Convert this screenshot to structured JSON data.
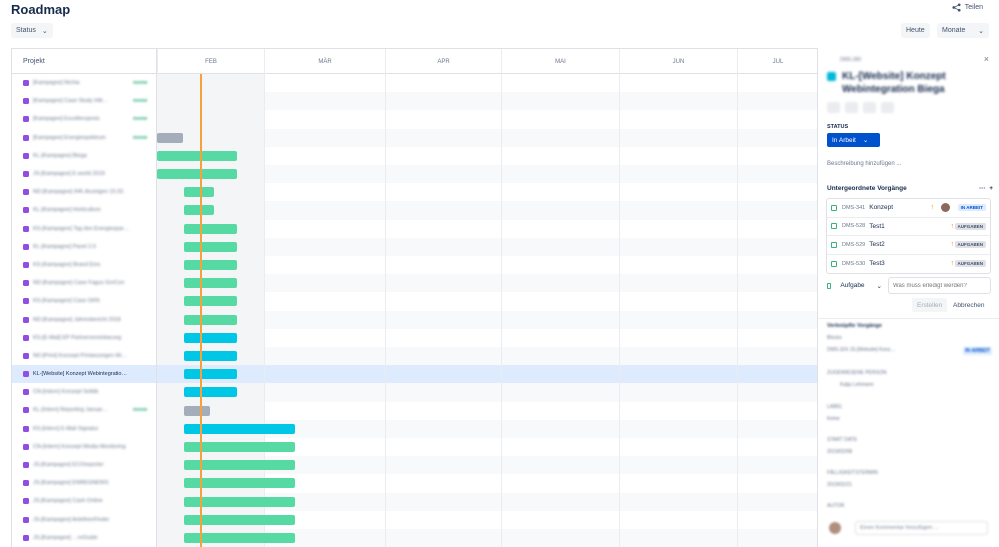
{
  "header": {
    "title": "Roadmap",
    "share_label": "Teilen",
    "status_filter": "Status",
    "today_button": "Heute",
    "zoom_select": "Monate"
  },
  "left_column": {
    "header": "Projekt",
    "rows": [
      {
        "label": "[Kampagne] Nichia",
        "tag": "meme"
      },
      {
        "label": "[Kampagne] Case Study Hitt…",
        "tag": "meme"
      },
      {
        "label": "[Kampagne] Excellenzpreis",
        "tag": "meme"
      },
      {
        "label": "[Kampagne] Energiespektrum",
        "tag": "meme"
      },
      {
        "label": "KL-[Kampagne] Biega",
        "tag": ""
      },
      {
        "label": "JS-[Kampagne] E-world 2019",
        "tag": ""
      },
      {
        "label": "ND-[Kampagne] IHK-Anzeigen 15.02.",
        "tag": ""
      },
      {
        "label": "KL-[Kampagne] Horticulture",
        "tag": ""
      },
      {
        "label": "KS-[Kampagne] Tag des Energiespar…",
        "tag": ""
      },
      {
        "label": "KL-[Kampagne] Panel 2.0",
        "tag": ""
      },
      {
        "label": "KS-[Kampagne] Brand Eins",
        "tag": ""
      },
      {
        "label": "ND-[Kampagne] Case Fagus GreCon",
        "tag": ""
      },
      {
        "label": "KS-[Kampagne] Case GKN",
        "tag": ""
      },
      {
        "label": "ND-[Kampagne] Jahresbericht 2018",
        "tag": ""
      },
      {
        "label": "KS-[E-Mail] EP Partnervereinbarung",
        "tag": ""
      },
      {
        "label": "ND-[Print] Konzept Printanzeigen Mi…",
        "tag": ""
      },
      {
        "label": "KL-[Website] Konzept Webintegratio…",
        "tag": ""
      },
      {
        "label": "CN-[Intern] Konzept Selbtk",
        "tag": ""
      },
      {
        "label": "KL-[Intern] Reporting Januar…",
        "tag": "meme"
      },
      {
        "label": "KS-[Intern] E-Mail Signatur",
        "tag": ""
      },
      {
        "label": "CN-[Intern] Konzept Media-Monitoring",
        "tag": ""
      },
      {
        "label": "JS-[Kampagne] ECOreporter",
        "tag": ""
      },
      {
        "label": "JS-[Kampagne] ENREGNEWS",
        "tag": ""
      },
      {
        "label": "JS-[Kampagne] Cash Online",
        "tag": ""
      },
      {
        "label": "JS-[Kampagne] AnlethenFinder",
        "tag": ""
      },
      {
        "label": "JS-[Kampagne] …reGuide",
        "tag": ""
      }
    ]
  },
  "timeline": {
    "months": [
      "FEB",
      "MÄR",
      "APR",
      "MAI",
      "JUN",
      "JUL"
    ],
    "bars": [
      {
        "row": 3,
        "start": 0,
        "end": 26,
        "color": "grey"
      },
      {
        "row": 4,
        "start": 0,
        "end": 80,
        "color": "green"
      },
      {
        "row": 5,
        "start": 0,
        "end": 80,
        "color": "green"
      },
      {
        "row": 6,
        "start": 27,
        "end": 57,
        "color": "green"
      },
      {
        "row": 7,
        "start": 27,
        "end": 57,
        "color": "green"
      },
      {
        "row": 8,
        "start": 27,
        "end": 80,
        "color": "green"
      },
      {
        "row": 9,
        "start": 27,
        "end": 80,
        "color": "green"
      },
      {
        "row": 10,
        "start": 27,
        "end": 80,
        "color": "green"
      },
      {
        "row": 11,
        "start": 27,
        "end": 80,
        "color": "green"
      },
      {
        "row": 12,
        "start": 27,
        "end": 80,
        "color": "green"
      },
      {
        "row": 13,
        "start": 27,
        "end": 80,
        "color": "green"
      },
      {
        "row": 14,
        "start": 27,
        "end": 80,
        "color": "blue"
      },
      {
        "row": 15,
        "start": 27,
        "end": 80,
        "color": "blue"
      },
      {
        "row": 16,
        "start": 27,
        "end": 80,
        "color": "blue"
      },
      {
        "row": 17,
        "start": 27,
        "end": 80,
        "color": "blue"
      },
      {
        "row": 18,
        "start": 27,
        "end": 53,
        "color": "grey"
      },
      {
        "row": 19,
        "start": 27,
        "end": 138,
        "color": "blue"
      },
      {
        "row": 20,
        "start": 27,
        "end": 138,
        "color": "green"
      },
      {
        "row": 21,
        "start": 27,
        "end": 138,
        "color": "green"
      },
      {
        "row": 22,
        "start": 27,
        "end": 138,
        "color": "green"
      },
      {
        "row": 23,
        "start": 27,
        "end": 138,
        "color": "green"
      },
      {
        "row": 24,
        "start": 27,
        "end": 138,
        "color": "green"
      },
      {
        "row": 25,
        "start": 27,
        "end": 138,
        "color": "green"
      }
    ]
  },
  "panel": {
    "key": "DMS-280",
    "title": "KL-[Website] Konzept Webintegration Biega",
    "status_label": "STATUS",
    "status_value": "In Arbeit",
    "description_placeholder": "Beschreibung hinzufügen ...",
    "subtasks_title": "Untergeordnete Vorgänge",
    "subtasks": [
      {
        "key": "DMS-341",
        "name": "Konzept",
        "status": "IN ARBEIT"
      },
      {
        "key": "DMS-528",
        "name": "Test1",
        "status": "AUFGABEN"
      },
      {
        "key": "DMS-529",
        "name": "Test2",
        "status": "AUFGABEN"
      },
      {
        "key": "DMS-530",
        "name": "Test3",
        "status": "AUFGABEN"
      }
    ],
    "task_type": "Aufgabe",
    "task_placeholder": "Was muss erledigt werden?",
    "create_button": "Erstellen",
    "cancel_button": "Abbrechen",
    "linked_title": "Verknüpfte Vorgänge",
    "linked_sub": "Blocks",
    "linked_item": "DMS-324 JS-[Website] Konz…",
    "linked_status": "IN ARBEIT",
    "assignee_label": "ZUGEWIESENE PERSON",
    "assignee": "Katja Lehmann",
    "labels_label": "LABEL",
    "labels_value": "Keine",
    "start_label": "START DATE",
    "start_value": "2019/02/08",
    "due_label": "FÄLLIGKEITSTERMIN",
    "due_value": "2019/02/21",
    "author_label": "AUTOR",
    "comment_placeholder": "Einen Kommentar hinzufügen ..."
  },
  "colors": {
    "green_bar": "#57d9a3",
    "blue_bar": "#00c7e6",
    "grey_bar": "#a5adba",
    "today_line": "#f6a23c",
    "primary": "#0052cc"
  }
}
